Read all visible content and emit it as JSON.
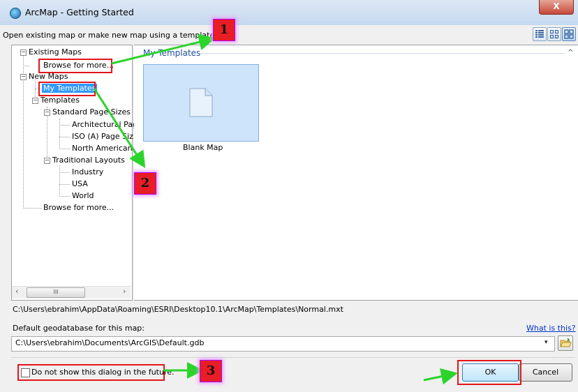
{
  "window": {
    "title": "ArcMap - Getting Started",
    "close_glyph": "X"
  },
  "instruction": "Open existing map or make new map using a template",
  "view_buttons": [
    "list-view-icon",
    "small-icons-view-icon",
    "large-icons-view-icon"
  ],
  "tree": {
    "existing_maps": "Existing Maps",
    "browse_existing": "Browse for more...",
    "new_maps": "New Maps",
    "my_templates": "My Templates",
    "templates": "Templates",
    "standard_page_sizes": "Standard Page Sizes",
    "architectural": "Architectural Pag",
    "iso": "ISO (A) Page Siz",
    "north_american": "North American (",
    "traditional_layouts": "Traditional Layouts",
    "industry": "Industry",
    "usa": "USA",
    "world": "World",
    "browse_templates": "Browse for more..."
  },
  "scrollbar": {
    "left_arrow": "‹",
    "right_arrow": "›",
    "grip": "III"
  },
  "content": {
    "section_title": "My Templates",
    "collapse_glyph": "^",
    "tile_label": "Blank Map"
  },
  "template_path": "C:\\Users\\ebrahim\\AppData\\Roaming\\ESRI\\Desktop10.1\\ArcMap\\Templates\\Normal.mxt",
  "geodatabase": {
    "label": "Default geodatabase for this map:",
    "help_link": "What is this?",
    "value": "C:\\Users\\ebrahim\\Documents\\ArcGIS\\Default.gdb",
    "dropdown_glyph": "▾"
  },
  "checkbox_label": "Do not show this dialog in the future.",
  "buttons": {
    "ok": "OK",
    "cancel": "Cancel"
  },
  "annotations": {
    "step1": "1",
    "step2": "2",
    "step3": "3",
    "box_color": "#e3161b",
    "arrow_color": "#2bd42b"
  }
}
